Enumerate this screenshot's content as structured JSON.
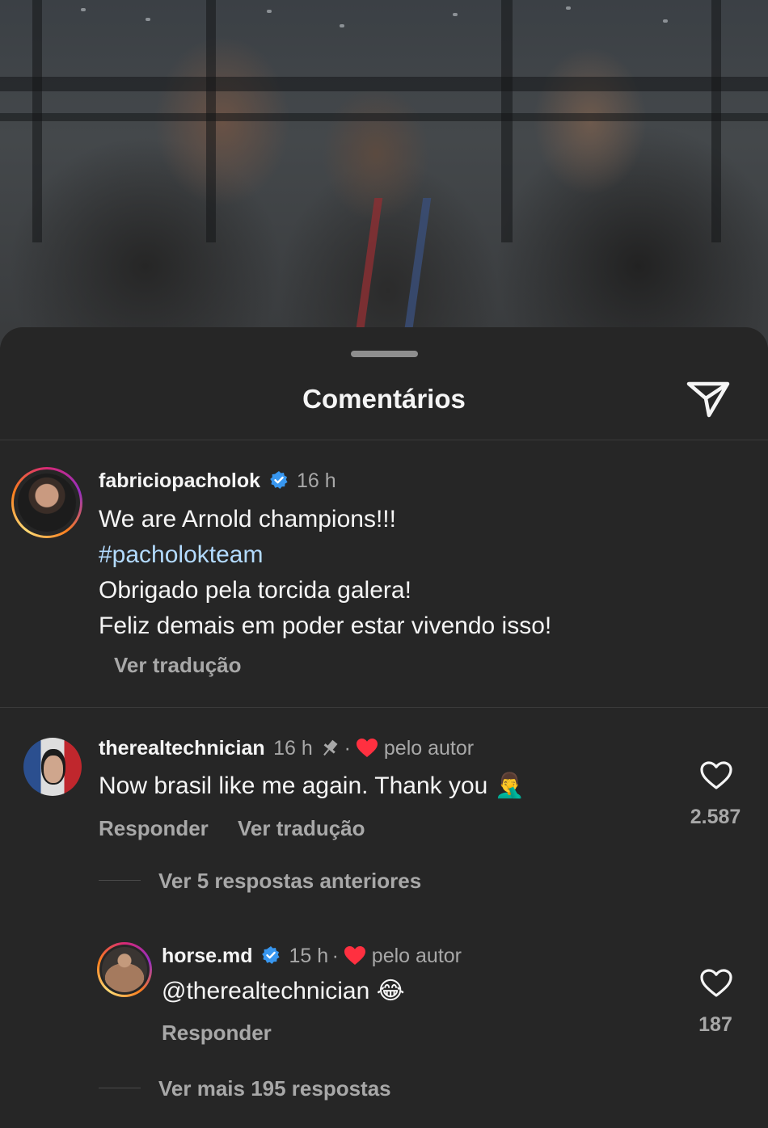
{
  "sheet": {
    "title": "Comentários"
  },
  "caption": {
    "username": "fabriciopacholok",
    "time": "16 h",
    "lines": [
      "We are Arnold champions!!!",
      "#pacholokteam",
      "Obrigado pela torcida galera!",
      "Feliz demais em poder estar vivendo isso!"
    ],
    "translate": "Ver tradução"
  },
  "comments": [
    {
      "username": "therealtechnician",
      "time": "16 h",
      "separator": "·",
      "liked_by_author": "pelo autor",
      "text": "Now brasil like me again. Thank you 🤦‍♂️",
      "reply": "Responder",
      "translate": "Ver tradução",
      "likes": "2.587",
      "view_replies": "Ver 5 respostas anteriores"
    }
  ],
  "replies": [
    {
      "username": "horse.md",
      "time": "15 h",
      "separator": "·",
      "liked_by_author": "pelo autor",
      "text": "@therealtechnician 😂",
      "reply": "Responder",
      "likes": "187",
      "view_more": "Ver mais 195 respostas"
    }
  ],
  "icons": {
    "share": "paper-plane-icon",
    "verified": "verified-badge-icon",
    "pin": "pin-icon",
    "heart_filled": "heart-filled-icon",
    "heart_outline": "heart-outline-icon"
  },
  "colors": {
    "background": "#262626",
    "verified": "#3897f0",
    "heart": "#ff3040",
    "secondary_text": "#a8a8a8"
  }
}
